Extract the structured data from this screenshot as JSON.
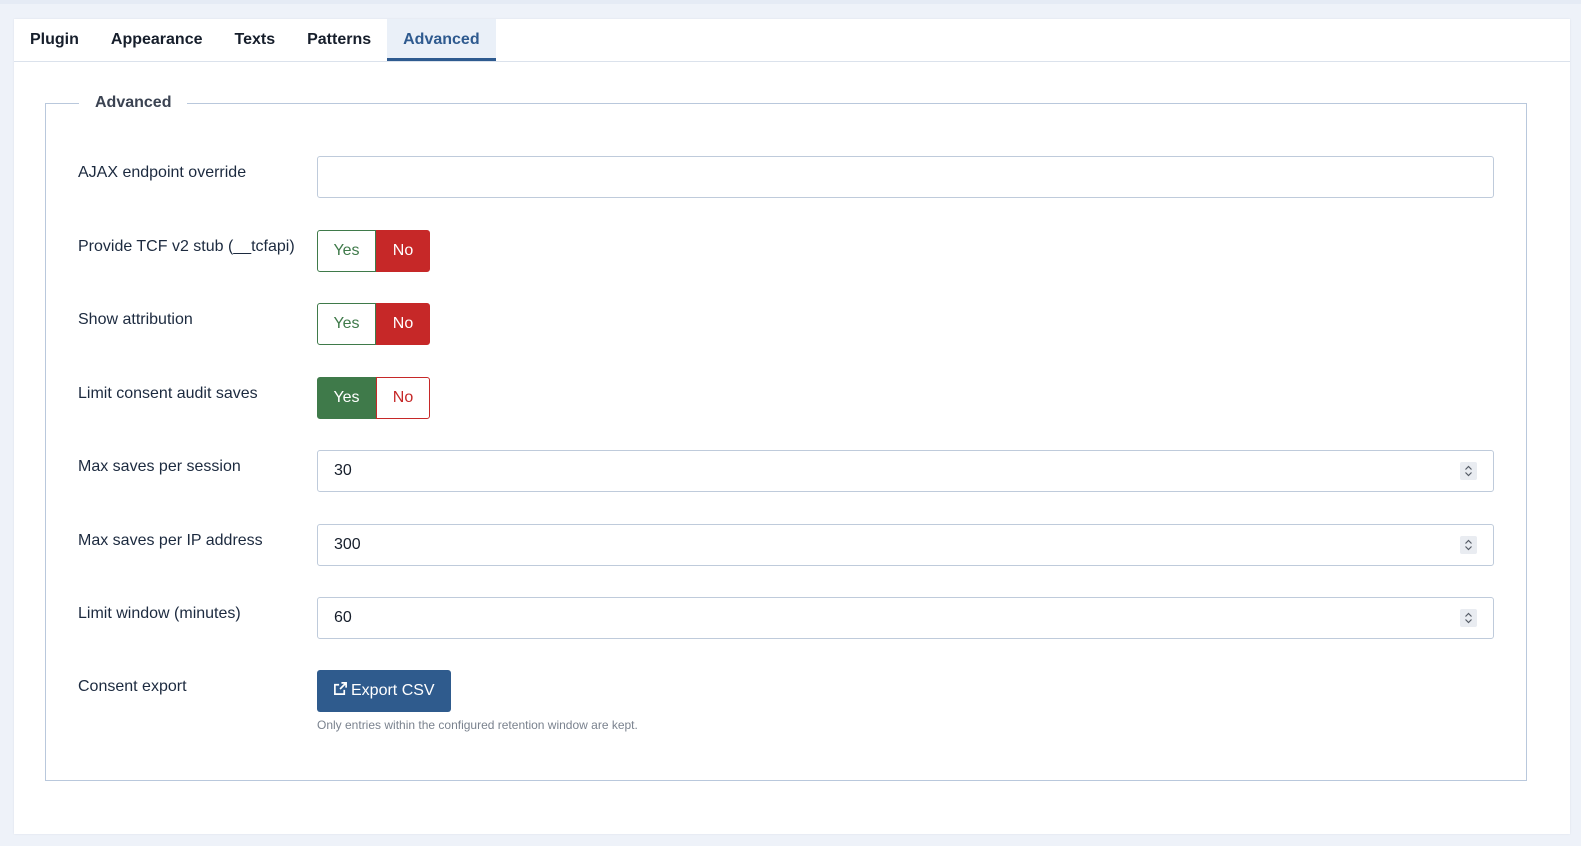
{
  "tabs": [
    {
      "label": "Plugin",
      "active": false
    },
    {
      "label": "Appearance",
      "active": false
    },
    {
      "label": "Texts",
      "active": false
    },
    {
      "label": "Patterns",
      "active": false
    },
    {
      "label": "Advanced",
      "active": true
    }
  ],
  "fieldset": {
    "legend": "Advanced"
  },
  "fields": {
    "ajax_endpoint": {
      "label": "AJAX endpoint override",
      "value": ""
    },
    "tcf_stub": {
      "label": "Provide TCF v2 stub (__tcfapi)",
      "yes": "Yes",
      "no": "No",
      "selected": "No"
    },
    "attribution": {
      "label": "Show attribution",
      "yes": "Yes",
      "no": "No",
      "selected": "No"
    },
    "limit_saves": {
      "label": "Limit consent audit saves",
      "yes": "Yes",
      "no": "No",
      "selected": "Yes"
    },
    "max_session": {
      "label": "Max saves per session",
      "value": "30"
    },
    "max_ip": {
      "label": "Max saves per IP address",
      "value": "300"
    },
    "window": {
      "label": "Limit window (minutes)",
      "value": "60"
    },
    "export": {
      "label": "Consent export",
      "button": "Export CSV",
      "hint": "Only entries within the configured retention window are kept."
    }
  },
  "colors": {
    "primary": "#2f5b8d",
    "success": "#3f7a4a",
    "danger": "#c62828"
  },
  "icons": {
    "export": "external-link-icon",
    "spinner": "number-spinner-icon"
  }
}
